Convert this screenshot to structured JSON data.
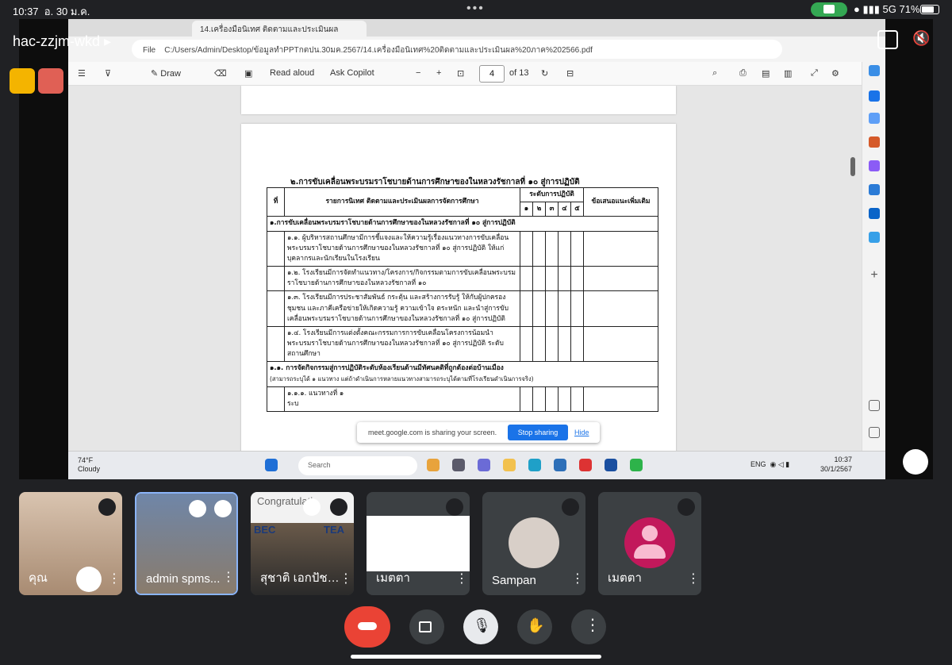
{
  "status_bar": {
    "time": "10:37",
    "date": "อ. 30 ม.ค.",
    "network": "5G",
    "battery": "71%"
  },
  "meeting": {
    "code": "hac-zzjm-wkd"
  },
  "browser": {
    "tab_title": "14.เครื่องมือนิเทศ ติดตามและประเมินผล",
    "file_label": "File",
    "address": "C:/Users/Admin/Desktop/ข้อมูลทำPPTกตปน.30มค.2567/14.เครื่องมือนิเทศ%20ติดตามและประเมินผล%20ภาค%202566.pdf"
  },
  "pdf_toolbar": {
    "draw": "Draw",
    "read_aloud": "Read aloud",
    "ask_copilot": "Ask Copilot",
    "page_number": "4",
    "page_total": "of 13"
  },
  "document": {
    "heading": "๒.การขับเคลื่อนพระบรมราโชบายด้านการศึกษาของในหลวงรัชกาลที่ ๑๐ สู่การปฏิบัติ",
    "col_no": "ที่",
    "col_item": "รายการนิเทศ ติดตามและประเมินผลการจัดการศึกษา",
    "col_level": "ระดับการปฏิบัติ",
    "col_suggest": "ข้อเสนอแนะเพิ่มเติม",
    "levels": [
      "๑",
      "๒",
      "๓",
      "๔",
      "๕"
    ],
    "section1": "๑.การขับเคลื่อนพระบรมราโชบายด้านการศึกษาของในหลวงรัชกาลที่ ๑๐ สู่การปฏิบัติ",
    "rows": [
      "๑.๑. ผู้บริหารสถานศึกษามีการชี้แจงและให้ความรู้เรื่องแนวทางการขับเคลื่อนพระบรมราโชบายด้านการศึกษาของในหลวงรัชกาลที่ ๑๐ สู่การปฏิบัติ ให้แก่บุคลากรและนักเรียนในโรงเรียน",
      "๑.๒. โรงเรียนมีการจัดทำแนวทาง/โครงการ/กิจกรรมตามการขับเคลื่อนพระบรมราโชบายด้านการศึกษาของในหลวงรัชกาลที่ ๑๐",
      "๑.๓. โรงเรียนมีการประชาสัมพันธ์ กระตุ้น และสร้างการรับรู้ ให้กับผู้ปกครอง ชุมชน และภาคีเครือข่ายให้เกิดความรู้ ความเข้าใจ ตระหนัก และนำสู่การขับเคลื่อนพระบรมราโชบายด้านการศึกษาของในหลวงรัชกาลที่ ๑๐ สู่การปฏิบัติ",
      "๑.๔. โรงเรียนมีการแต่งตั้งคณะกรรมการการขับเคลื่อนโครงการน้อมนำพระบรมราโชบายด้านการศึกษาของในหลวงรัชกาลที่ ๑๐ สู่การปฏิบัติ ระดับสถานศึกษา"
    ],
    "section2": "๑.๑. การจัดกิจกรรมสู่การปฏิบัติระดับห้องเรียนด้านมีทัศนคติที่ถูกต้องต่อบ้านเมือง",
    "section2_note": "(สามารถระบุได้ ๑ แนวทาง แต่ถ้าดำเนินการหลายแนวทางสามารถระบุได้ตามที่โรงเรียนดำเนินการจริง)",
    "sub_row": "๑.๑.๑. แนวทางที่ ๑",
    "sub_row2": "ระบ"
  },
  "share_banner": {
    "message": "meet.google.com is sharing your screen.",
    "stop": "Stop sharing",
    "hide": "Hide"
  },
  "taskbar": {
    "temp": "74°F",
    "weather": "Cloudy",
    "search": "Search",
    "lang": "ENG",
    "time": "10:37",
    "date": "30/1/2567"
  },
  "participants": [
    {
      "name": "คุณ"
    },
    {
      "name": "admin spms..."
    },
    {
      "name": "สุชาติ เอกปัชชา"
    },
    {
      "name": "เมตตา"
    },
    {
      "name": "Sampan"
    },
    {
      "name": "เมตตา"
    }
  ],
  "thumbnails": {
    "p3_banner": "Congratulati",
    "p3_sign": "BEC",
    "p3_sign2": "TEA"
  },
  "colors": {
    "end_call": "#ea4335",
    "active_tile_border": "#8ab4f8",
    "stop_sharing": "#1a73e8",
    "avatar_pink": "#c2185b"
  }
}
